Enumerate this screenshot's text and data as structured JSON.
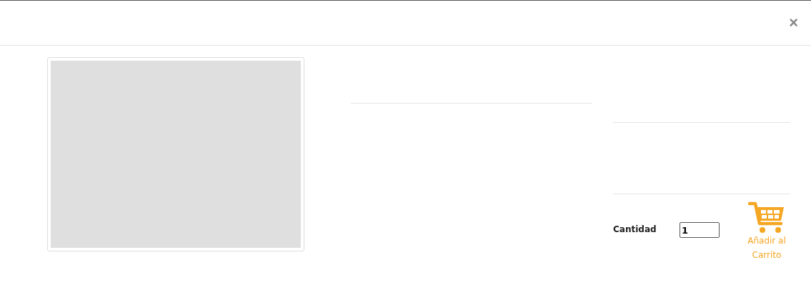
{
  "close_button": {
    "label": "×"
  },
  "product_image": {
    "kind": "placeholder"
  },
  "quantity": {
    "label": "Cantidad",
    "value": "1"
  },
  "add_to_cart": {
    "label": "Añadir al Carrito"
  }
}
